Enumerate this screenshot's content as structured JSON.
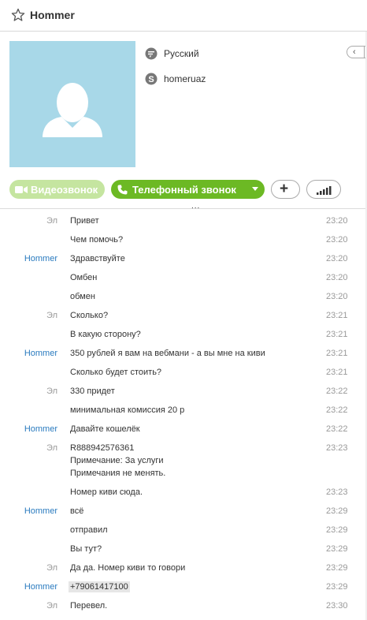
{
  "header": {
    "title": "Hommer",
    "star_icon": "star-icon"
  },
  "profile": {
    "language": "Русский",
    "skype_name": "homeruaz",
    "avatar_bg": "#a8d8e8"
  },
  "nav": {
    "prev_label": "‹"
  },
  "actions": {
    "video_label": "Видеозвонок",
    "phone_label": "Телефонный звонок",
    "add_label": "+",
    "accent": "#6cb924"
  },
  "more_dots": "...",
  "messages": [
    {
      "sender": "Эл",
      "text": "Привет",
      "time": "23:20"
    },
    {
      "sender": "",
      "text": "Чем помочь?",
      "time": "23:20"
    },
    {
      "sender": "Hommer",
      "text": "Здравствуйте",
      "time": "23:20"
    },
    {
      "sender": "",
      "text": "Омбен",
      "time": "23:20"
    },
    {
      "sender": "",
      "text": "обмен",
      "time": "23:20"
    },
    {
      "sender": "Эл",
      "text": "Сколько?",
      "time": "23:21"
    },
    {
      "sender": "",
      "text": "В какую сторону?",
      "time": "23:21"
    },
    {
      "sender": "Hommer",
      "text": "350 рублей я вам на вебмани - а вы мне на киви",
      "time": "23:21"
    },
    {
      "sender": "",
      "text": "Сколько будет стоить?",
      "time": "23:21"
    },
    {
      "sender": "Эл",
      "text": "330 придет",
      "time": "23:22"
    },
    {
      "sender": "",
      "text": "минимальная комиссия 20 р",
      "time": "23:22"
    },
    {
      "sender": "Hommer",
      "text": "Давайте кошелёк",
      "time": "23:22"
    },
    {
      "sender": "Эл",
      "text": "R888942576361\nПримечание: За услуги\nПримечания не менять.",
      "time": "23:23"
    },
    {
      "sender": "",
      "text": "Номер киви сюда.",
      "time": "23:23"
    },
    {
      "sender": "Hommer",
      "text": "всё",
      "time": "23:29"
    },
    {
      "sender": "",
      "text": "отправил",
      "time": "23:29"
    },
    {
      "sender": "",
      "text": "Вы тут?",
      "time": "23:29"
    },
    {
      "sender": "Эл",
      "text": "Да да. Номер киви то говори",
      "time": "23:29"
    },
    {
      "sender": "Hommer",
      "text": "+79061417100",
      "time": "23:29"
    },
    {
      "sender": "Эл",
      "text": "Перевел.",
      "time": "23:30"
    }
  ]
}
